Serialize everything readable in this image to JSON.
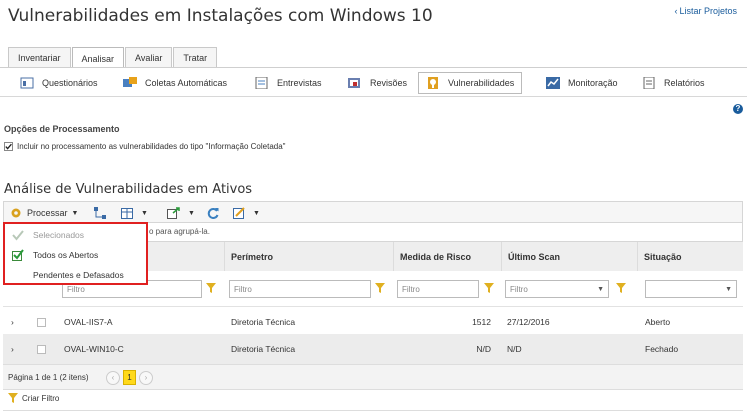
{
  "header": {
    "title": "Vulnerabilidades em Instalações com Windows 10",
    "back_link": "Listar Projetos"
  },
  "tabs": [
    {
      "label": "Inventariar"
    },
    {
      "label": "Analisar"
    },
    {
      "label": "Avaliar"
    },
    {
      "label": "Tratar"
    }
  ],
  "subnav": [
    {
      "label": "Questionários",
      "icon": "questionnaire-icon"
    },
    {
      "label": "Coletas Automáticas",
      "icon": "auto-collection-icon"
    },
    {
      "label": "Entrevistas",
      "icon": "interview-icon"
    },
    {
      "label": "Revisões",
      "icon": "review-icon"
    },
    {
      "label": "Vulnerabilidades",
      "icon": "vulnerability-icon"
    },
    {
      "label": "Monitoração",
      "icon": "monitoring-icon"
    },
    {
      "label": "Relatórios",
      "icon": "report-icon"
    }
  ],
  "processing": {
    "title": "Opções de Processamento",
    "include_label": "Incluir no processamento as vulnerabilidades do tipo \"Informação Coletada\"",
    "include_checked": true
  },
  "analysis": {
    "title": "Análise de Vulnerabilidades em Ativos"
  },
  "toolbar": {
    "process_label": "Processar"
  },
  "group_hint": "o para agrupá-la.",
  "dropdown": {
    "items": [
      {
        "label": "Selecionados",
        "disabled": true
      },
      {
        "label": "Todos os Abertos",
        "disabled": false
      },
      {
        "label": "Pendentes e Defasados",
        "disabled": false
      }
    ]
  },
  "table": {
    "columns": [
      "Perímetro",
      "Medida de Risco",
      "Último Scan",
      "Situação"
    ],
    "filter_placeholder": "Filtro",
    "rows": [
      {
        "name": "OVAL-IIS7-A",
        "perimeter": "Diretoria Técnica",
        "risk": "1512",
        "last_scan": "27/12/2016",
        "status": "Aberto"
      },
      {
        "name": "OVAL-WIN10-C",
        "perimeter": "Diretoria Técnica",
        "risk": "N/D",
        "last_scan": "N/D",
        "status": "Fechado"
      }
    ]
  },
  "pager": {
    "text": "Página 1 de 1 (2 itens)",
    "current": "1"
  },
  "create_filter": "Criar Filtro",
  "colors": {
    "link": "#1a5c9c",
    "highlight": "#e02020",
    "page_current": "#ffd91a"
  }
}
